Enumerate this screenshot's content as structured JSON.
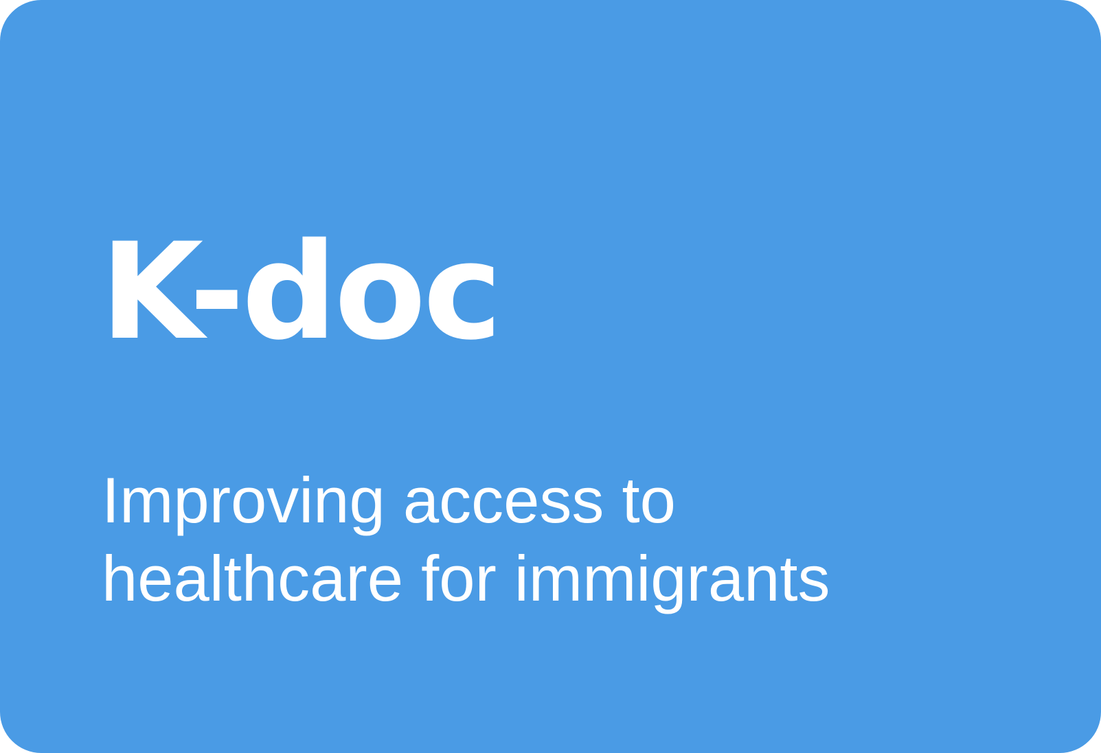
{
  "card": {
    "background_color": "#4a9be5",
    "text_color": "#ffffff",
    "title": "K-doc",
    "subtitle_lines": [
      "Improving access to",
      "healthcare for immigrants"
    ]
  }
}
